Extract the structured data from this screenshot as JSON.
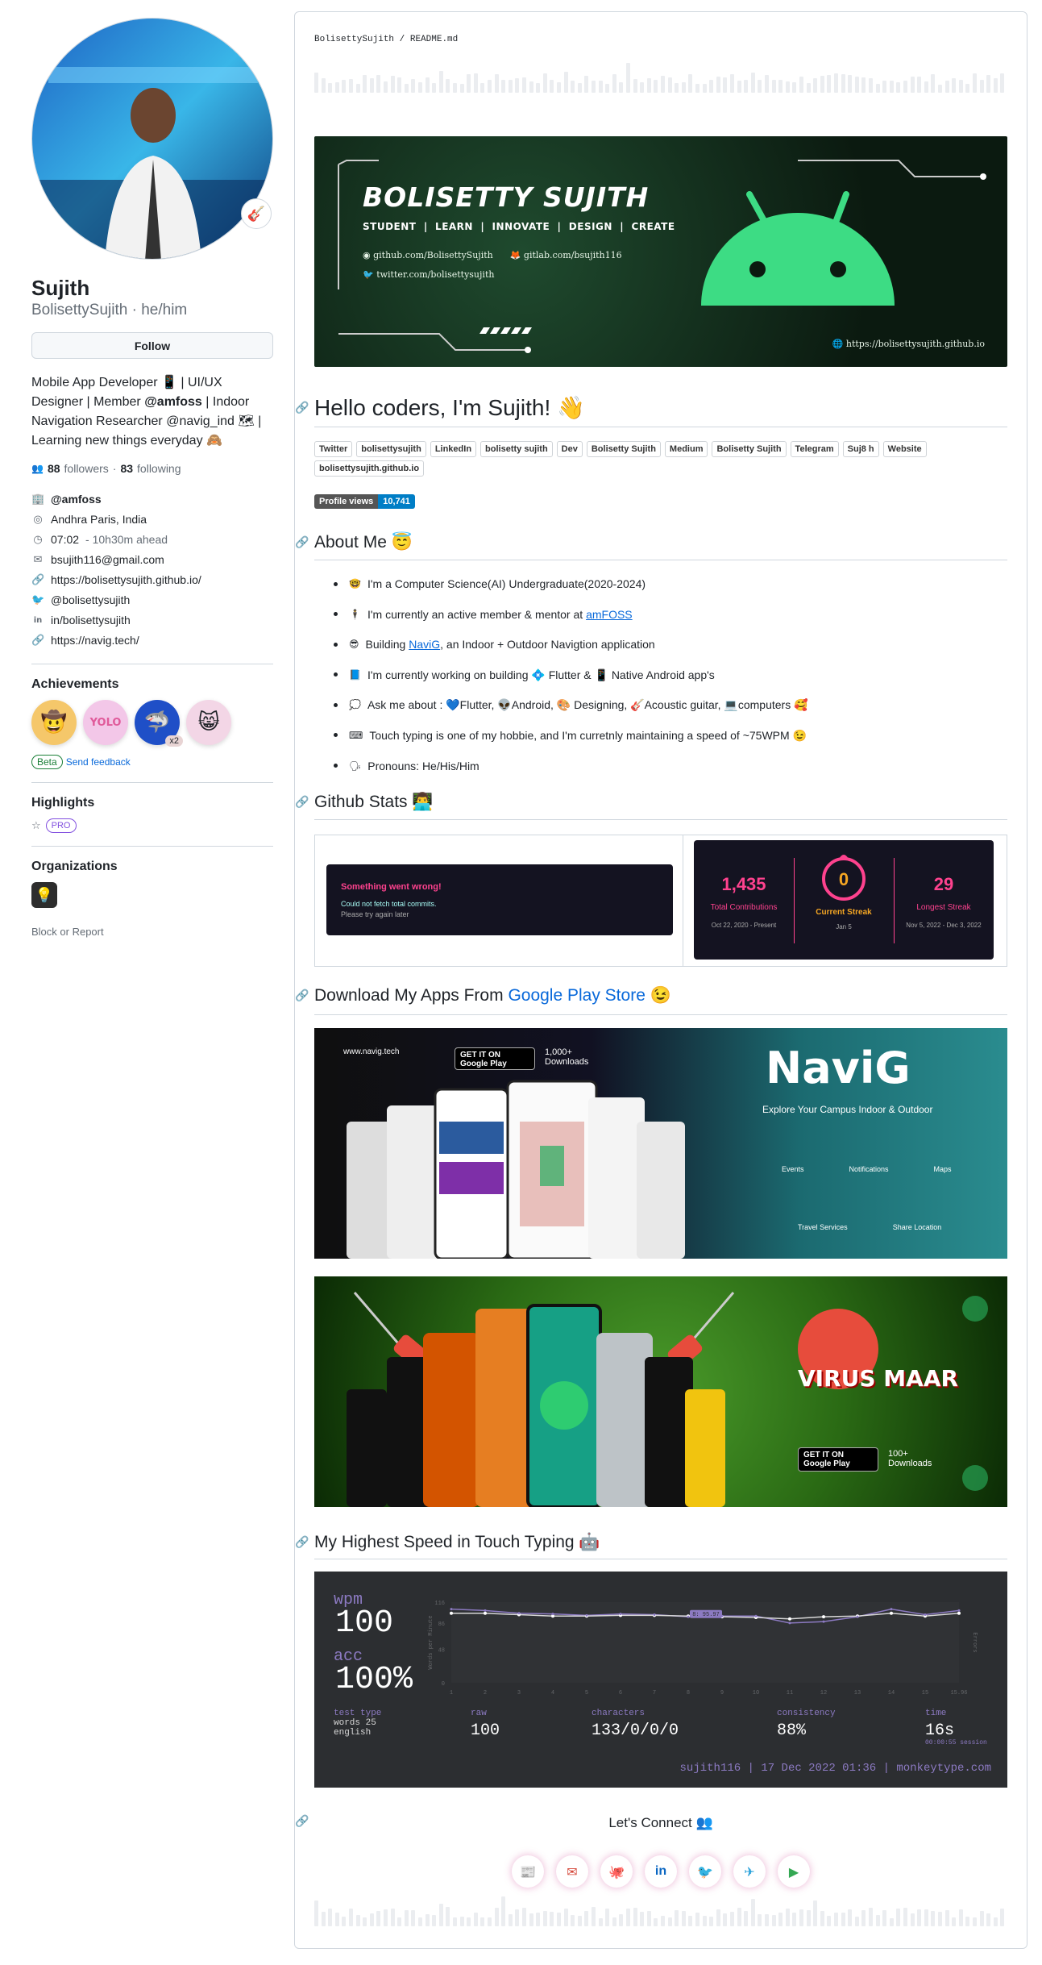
{
  "profile": {
    "name": "Sujith",
    "login": "BolisettySujith",
    "pronouns": "he/him",
    "follow_label": "Follow",
    "status_emoji": "🎸",
    "bio_part1": "Mobile App Developer 📱 | UI/UX Designer | Member ",
    "bio_org": "@amfoss",
    "bio_part2": " | Indoor Navigation Researcher @navig_ind 🗺 | Learning new things everyday 🙈",
    "followers": "88",
    "followers_label": "followers",
    "following": "83",
    "following_label": "following",
    "org": "@amfoss",
    "location": "Andhra Paris, India",
    "time": "07:02",
    "time_ahead": "- 10h30m ahead",
    "email": "bsujith116@gmail.com",
    "website": "https://bolisettysujith.github.io/",
    "twitter": "@bolisettysujith",
    "linkedin": "in/bolisettysujith",
    "extra_link": "https://navig.tech/"
  },
  "achievements": {
    "title": "Achievements",
    "items": [
      "🤠",
      "YOLO",
      "🦈",
      "😸"
    ],
    "multiplier": "x2",
    "beta": "Beta",
    "feedback": "Send feedback"
  },
  "highlights": {
    "title": "Highlights",
    "pro": "PRO"
  },
  "organizations": {
    "title": "Organizations",
    "block": "Block or Report"
  },
  "readme": {
    "breadcrumb_user": "BolisettySujith",
    "breadcrumb_sep": " / ",
    "breadcrumb_file": "README.md",
    "banner": {
      "title": "BOLISETTY SUJITH",
      "tags": "STUDENT  |  LEARN  |  INNOVATE  |  DESIGN  |  CREATE",
      "github": "github.com/BolisettySujith",
      "gitlab": "gitlab.com/bsujith116",
      "twitter": "twitter.com/bolisettysujith",
      "site": "https://bolisettysujith.github.io"
    },
    "hello": "Hello coders, I'm Sujith! 👋",
    "shields": [
      "Twitter",
      "bolisettysujith",
      "LinkedIn",
      "bolisetty sujith",
      "Dev",
      "Bolisetty Sujith",
      "Medium",
      "Bolisetty Sujith",
      "Telegram",
      "Suj8 h",
      "Website",
      "bolisettysujith.github.io"
    ],
    "profile_views_label": "Profile views",
    "profile_views": "10,741",
    "about_title": "About Me 😇",
    "about": [
      {
        "emoji": "🤓",
        "text": "I'm a Computer Science(AI) Undergraduate(2020-2024)"
      },
      {
        "emoji": "🕴",
        "text": "I'm currently an active member & mentor at ",
        "link": "amFOSS"
      },
      {
        "emoji": "😎",
        "text": "Building ",
        "link": "NaviG",
        "text2": ", an Indoor + Outdoor Navigtion application"
      },
      {
        "emoji": "📘",
        "text": "I'm currently working on building 💠 Flutter & 📱 Native Android app's"
      },
      {
        "emoji": "💭",
        "text": "Ask me about : 💙Flutter, 👽Android, 🎨 Designing, 🎸Acoustic guitar, 💻computers 🥰"
      },
      {
        "emoji": "⌨",
        "text": "Touch typing is one of my hobbie, and I'm curretnly maintaining a speed of ~75WPM 😉"
      },
      {
        "emoji": "🗣",
        "text": "Pronouns: He/His/Him"
      }
    ],
    "stats_title": "Github Stats 👨‍💻",
    "stats_error": {
      "title": "Something went wrong!",
      "sub": "Could not fetch total commits.",
      "sub2": "Please try again later"
    },
    "streak": {
      "total": "1,435",
      "total_label": "Total Contributions",
      "total_range": "Oct 22, 2020 - Present",
      "current": "0",
      "current_label": "Current Streak",
      "current_range": "Jan 5",
      "longest": "29",
      "longest_label": "Longest Streak",
      "longest_range": "Nov 5, 2022 - Dec 3, 2022"
    },
    "apps_title_prefix": "Download My Apps From ",
    "apps_title_link": "Google Play Store",
    "apps_title_suffix": " 😉",
    "navig": {
      "site": "www.navig.tech",
      "downloads": "1,000+ Downloads",
      "store": "GET IT ON Google Play",
      "name": "NaviG",
      "tagline": "Explore Your Campus Indoor & Outdoor",
      "features": [
        "Events",
        "Notifications",
        "Maps",
        "Travel Services",
        "Share Location"
      ]
    },
    "virus": {
      "name": "VIRUS MAAR",
      "downloads": "100+ Downloads",
      "store": "GET IT ON Google Play"
    },
    "typing_title": "My Highest Speed in Touch Typing 🤖",
    "monkeytype": {
      "wpm_label": "wpm",
      "wpm": "100",
      "acc_label": "acc",
      "acc": "100%",
      "test_type_label": "test type",
      "test_type": "words 25",
      "language": "english",
      "raw_label": "raw",
      "raw": "100",
      "characters_label": "characters",
      "characters": "133/0/0/0",
      "consistency_label": "consistency",
      "consistency": "88%",
      "time_label": "time",
      "time": "16s",
      "session": "00:00:55 session",
      "footer": "sujith116 | 17 Dec 2022 01:36 | monkeytype.com",
      "ylabel": "Words per Minute",
      "y2label": "Errors",
      "y_ticks": [
        "116",
        "86",
        "48",
        "0"
      ],
      "x_ticks": [
        "1",
        "2",
        "3",
        "4",
        "5",
        "6",
        "7",
        "8",
        "9",
        "10",
        "11",
        "12",
        "13",
        "14",
        "15",
        "15.96"
      ],
      "tooltip": "8: 95.97"
    },
    "connect": "Let's Connect 👥",
    "connect_icons": [
      "📰",
      "✉",
      "🐙",
      "in",
      "🐦",
      "✈",
      "▶"
    ]
  },
  "colors": {
    "accent": "#0969da",
    "streak": "#fe428e",
    "mt_main": "#8c7ac2",
    "android": "#3ddc84"
  }
}
